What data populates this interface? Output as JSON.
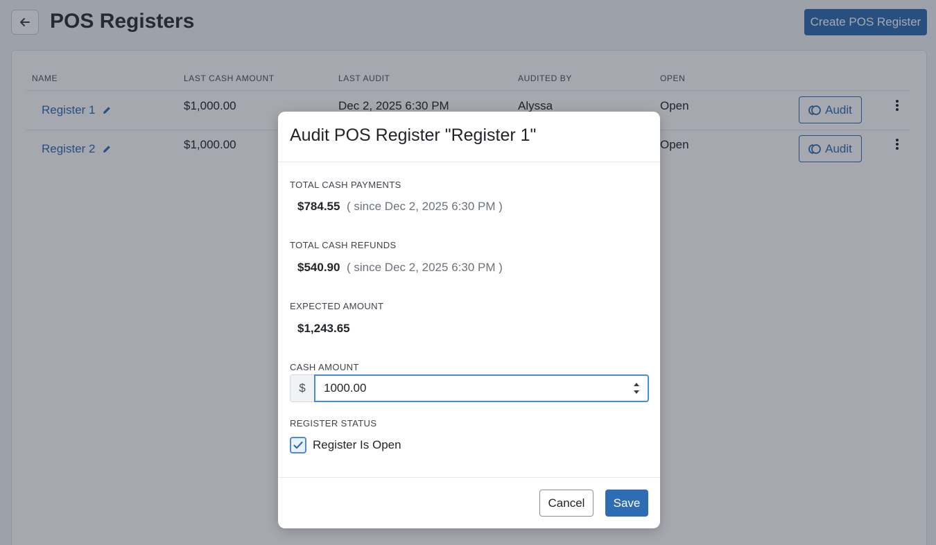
{
  "header": {
    "title": "POS Registers",
    "create_label": "Create POS Register"
  },
  "table": {
    "columns": [
      "NAME",
      "LAST CASH AMOUNT",
      "LAST AUDIT",
      "AUDITED BY",
      "OPEN"
    ],
    "rows": [
      {
        "name": "Register 1",
        "last_cash": "$1,000.00",
        "last_audit": "Dec 2, 2025 6:30 PM",
        "audited_by": "Alyssa",
        "open": "Open",
        "audit_label": "Audit"
      },
      {
        "name": "Register 2",
        "last_cash": "$1,000.00",
        "last_audit": "",
        "audited_by": "",
        "open": "Open",
        "audit_label": "Audit"
      }
    ]
  },
  "modal": {
    "title": "Audit POS Register \"Register 1\"",
    "payments_label": "TOTAL CASH PAYMENTS",
    "payments_value": "$784.55",
    "payments_since": "( since Dec 2, 2025 6:30 PM )",
    "refunds_label": "TOTAL CASH REFUNDS",
    "refunds_value": "$540.90",
    "refunds_since": "( since Dec 2, 2025 6:30 PM )",
    "expected_label": "EXPECTED AMOUNT",
    "expected_value": "$1,243.65",
    "cash_label": "CASH AMOUNT",
    "currency_prefix": "$",
    "cash_value": "1000.00",
    "status_label": "REGISTER STATUS",
    "open_checkbox_label": "Register Is Open",
    "open_checked": true,
    "cancel_label": "Cancel",
    "save_label": "Save"
  },
  "icons": {
    "back": "arrow-left-icon",
    "edit": "pencil-icon",
    "audit": "audit-icon",
    "menu": "kebab-menu-icon",
    "check": "checkmark-icon"
  },
  "colors": {
    "accent": "#2e6db4",
    "focus": "#4a8cd4",
    "backdrop": "#1e2634"
  }
}
